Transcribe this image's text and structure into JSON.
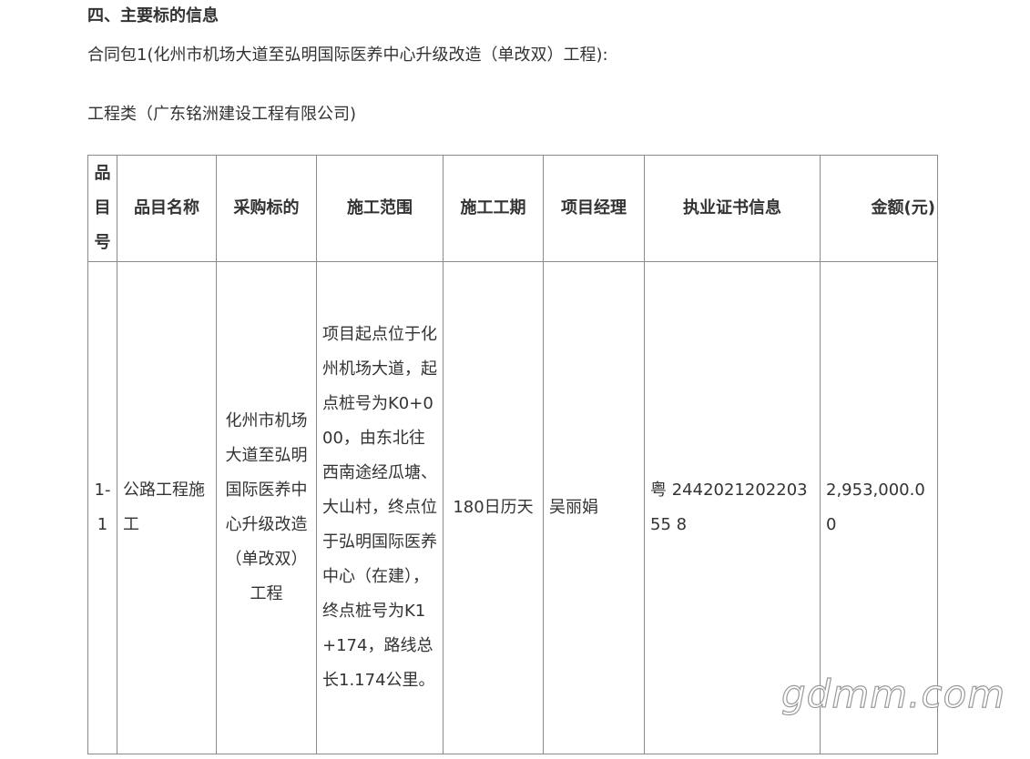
{
  "section_heading": "四、主要标的信息",
  "contract_package": "合同包1(化州市机场大道至弘明国际医养中心升级改造（单改双）工程):",
  "category_line": "工程类（广东铭洲建设工程有限公司)",
  "table": {
    "headers": {
      "item_no": "品目号",
      "item_name": "品目名称",
      "purchase_subject": "采购标的",
      "scope": "施工范围",
      "duration": "施工工期",
      "manager": "项目经理",
      "certificate": "执业证书信息",
      "amount": "金额(元)"
    },
    "rows": [
      {
        "item_no": "1-1",
        "item_name": "公路工程施工",
        "purchase_subject": "化州市机场大道至弘明国际医养中心升级改造（单改双）工程",
        "scope": "项目起点位于化州机场大道，起点桩号为K0+000，由东北往西南途经瓜塘、大山村，终点位于弘明国际医养中心（在建），终点桩号为K1+174，路线总长1.174公里。",
        "duration": "180日历天",
        "manager": "吴丽娟",
        "certificate": "粤 244202120220355 8",
        "amount": "2,953,000.00"
      }
    ]
  },
  "watermark": "gdmm.com"
}
